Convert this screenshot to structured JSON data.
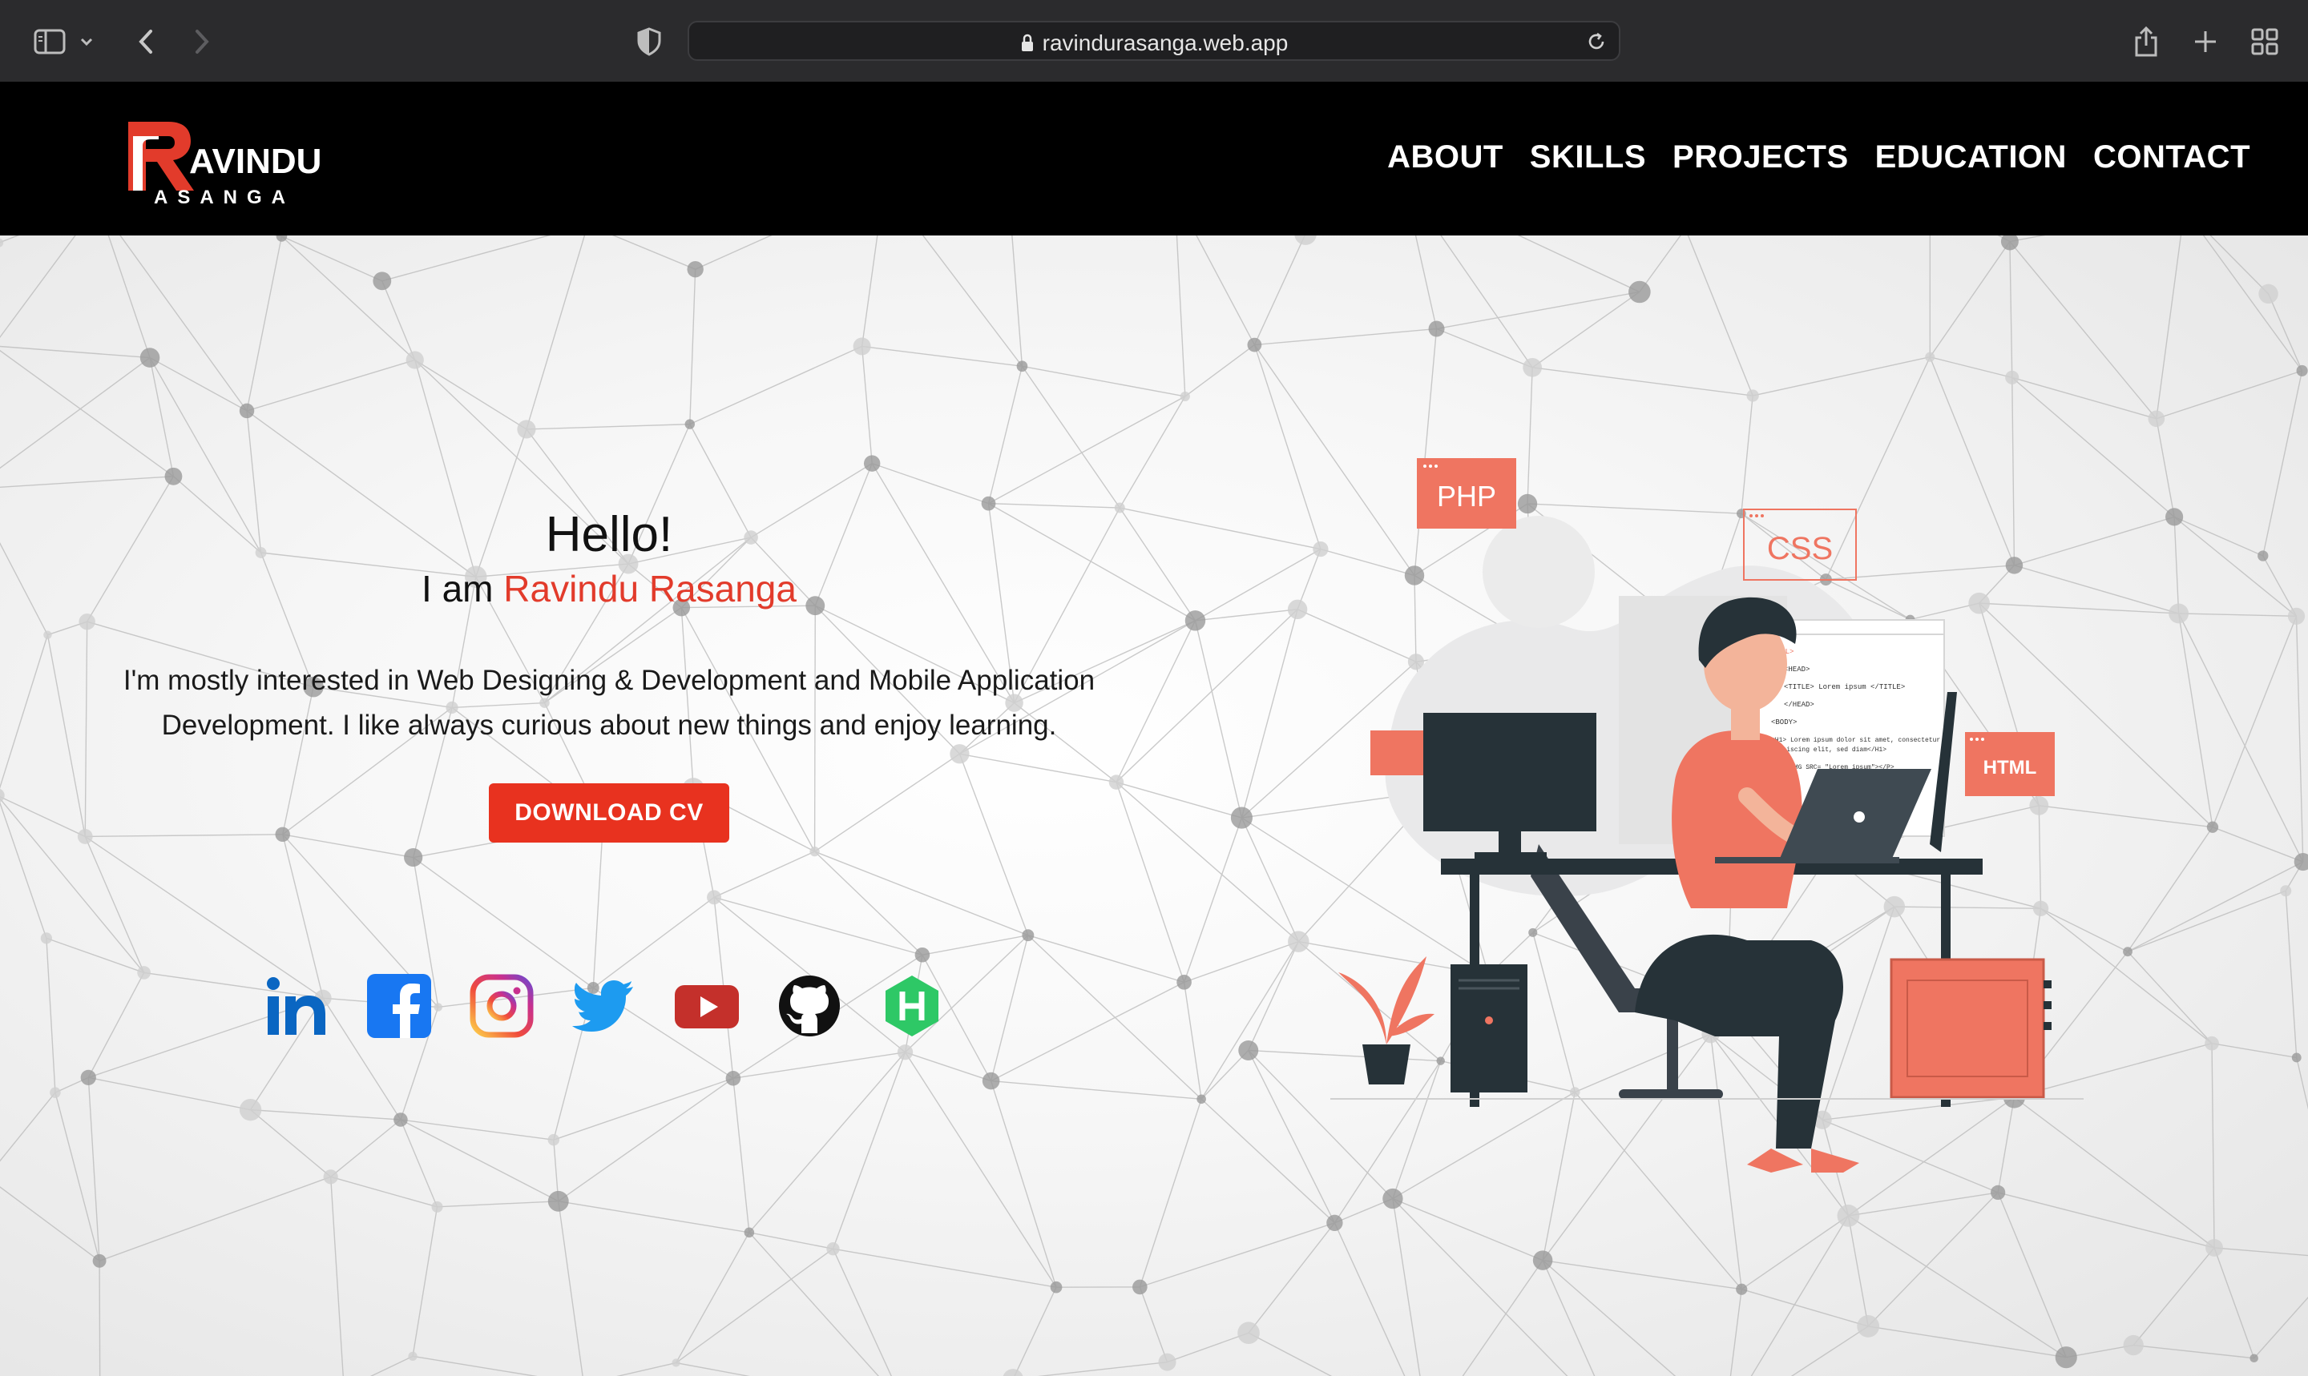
{
  "browser": {
    "url": "ravindurasanga.web.app"
  },
  "logo": {
    "line1": "AVINDU",
    "line2": "ASANGA"
  },
  "nav": [
    "ABOUT",
    "SKILLS",
    "PROJECTS",
    "EDUCATION",
    "CONTACT"
  ],
  "hero": {
    "greeting": "Hello!",
    "iam": "I am ",
    "name": "Ravindu Rasanga",
    "intro": "I'm mostly interested in Web Designing & Development and Mobile Application Development. I like always curious about new things and enjoy learning.",
    "cv_button": "DOWNLOAD CV"
  },
  "social": [
    "linkedin-icon",
    "facebook-icon",
    "instagram-icon",
    "twitter-icon",
    "youtube-icon",
    "github-icon",
    "hackerrank-icon"
  ],
  "illustration": {
    "tags": [
      "PHP",
      "CSS",
      "HTML"
    ],
    "code_lines": [
      "<HTML>",
      "<HEAD>",
      "<TITLE> Lorem ipsum </TITLE>",
      "</HEAD>",
      "<BODY>",
      "<H1> Lorem ipsum dolor sit amet, consectetur",
      "adipiscing elit, sed diam</H1>",
      "<P> <IMG SRC= \"Lorem ipsum\"></P>"
    ]
  },
  "colors": {
    "accent": "#e8321f",
    "name_red": "#e23b2b",
    "illus_coral": "#ef7561",
    "header_bg": "#000000"
  }
}
